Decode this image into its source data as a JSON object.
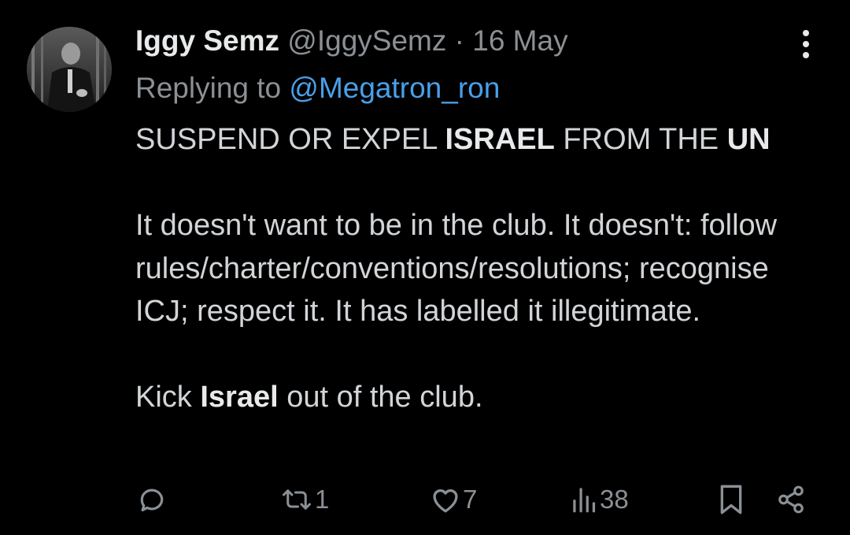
{
  "tweet": {
    "display_name": "Iggy Semz",
    "handle": "@IggySemz",
    "separator": "·",
    "date": "16 May",
    "replying_prefix": "Replying to",
    "replying_handle": "@Megatron_ron",
    "text": {
      "line1_part1": "SUSPEND OR EXPEL ",
      "line1_bold1": "ISRAEL",
      "line1_part2": " FROM THE ",
      "line1_bold2": "UN",
      "paragraph2": "It doesn't want to be in the club. It doesn't: follow rules/charter/conventions/resolutions; recognise ICJ; respect it. It has labelled it illegitimate.",
      "line3_part1": "Kick ",
      "line3_bold": "Israel",
      "line3_part2": " out of the club."
    }
  },
  "actions": {
    "reply_count": "",
    "retweet_count": "1",
    "like_count": "7",
    "views_count": "38"
  },
  "icons": {
    "more": "more-vertical-icon",
    "reply": "reply-icon",
    "retweet": "retweet-icon",
    "like": "heart-icon",
    "views": "views-icon",
    "bookmark": "bookmark-icon",
    "share": "share-icon"
  },
  "colors": {
    "background": "#000000",
    "text": "#e7e9ea",
    "secondary": "#8b9095",
    "link": "#4a9fe8"
  }
}
